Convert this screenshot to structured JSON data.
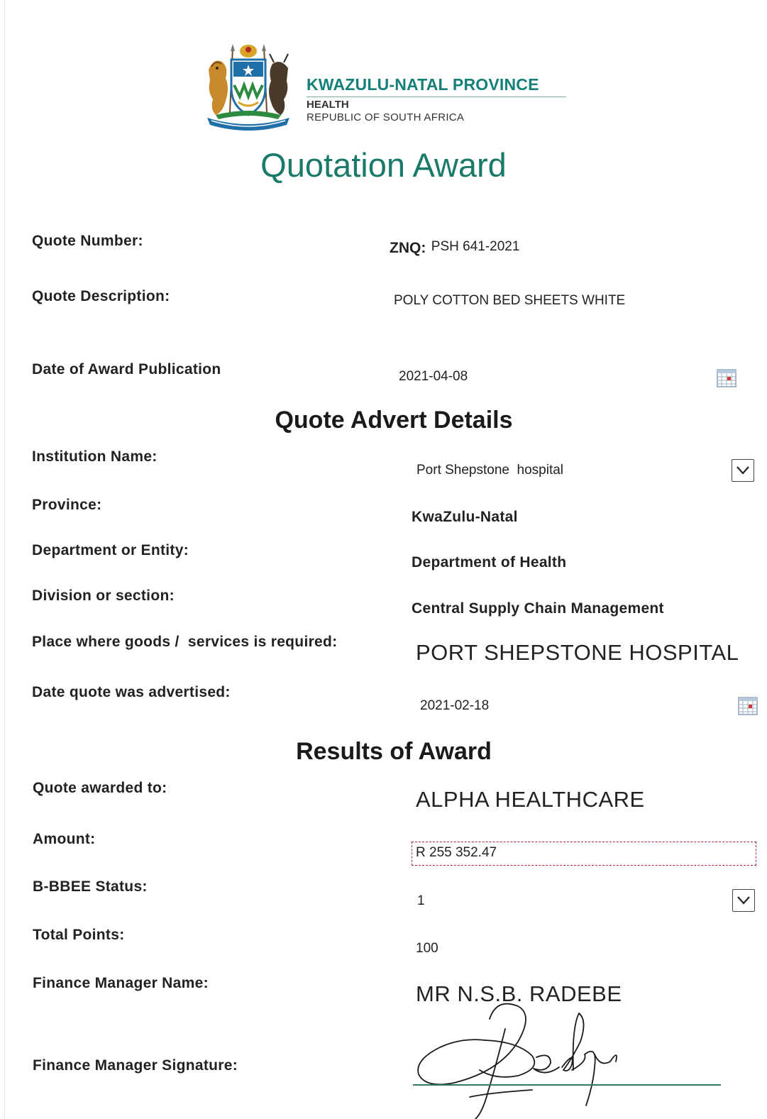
{
  "header": {
    "org_name": "KWAZULU-NATAL PROVINCE",
    "department": "HEALTH",
    "country": "REPUBLIC OF SOUTH AFRICA",
    "logo": "kzn-coat-of-arms-icon"
  },
  "title": "Quotation Award",
  "award": {
    "quote_number_label": "Quote Number:",
    "quote_number_prefix": "ZNQ:",
    "quote_number_value": "PSH 641-2021",
    "quote_description_label": "Quote Description:",
    "quote_description_value": "POLY COTTON BED SHEETS WHITE",
    "publication_date_label": "Date of Award Publication",
    "publication_date_value": "2021-04-08"
  },
  "advert": {
    "heading": "Quote Advert Details",
    "institution_label": "Institution Name:",
    "institution_value": "Port Shepstone  hospital",
    "province_label": "Province:",
    "province_value": "KwaZulu-Natal",
    "department_label": "Department or Entity:",
    "department_value": "Department of Health",
    "division_label": "Division or section:",
    "division_value": "Central Supply Chain Management",
    "place_label": "Place where goods /  services is required:",
    "place_value": "PORT SHEPSTONE HOSPITAL",
    "advertised_label": "Date quote was advertised:",
    "advertised_value": "2021-02-18"
  },
  "results": {
    "heading": "Results of Award",
    "awarded_to_label": "Quote awarded to:",
    "awarded_to_value": "ALPHA HEALTHCARE",
    "amount_label": "Amount:",
    "amount_value": "R 255 352.47",
    "bbbee_label": "B-BBEE Status:",
    "bbbee_value": "1",
    "total_points_label": "Total Points:",
    "total_points_value": "100",
    "finance_manager_label": "Finance Manager Name:",
    "finance_manager_value": "MR N.S.B. RADEBE",
    "signature_label": "Finance Manager Signature:"
  },
  "colors": {
    "brand_teal": "#15807a",
    "title_green": "#1a7a6a",
    "amount_border": "#b3263a"
  }
}
